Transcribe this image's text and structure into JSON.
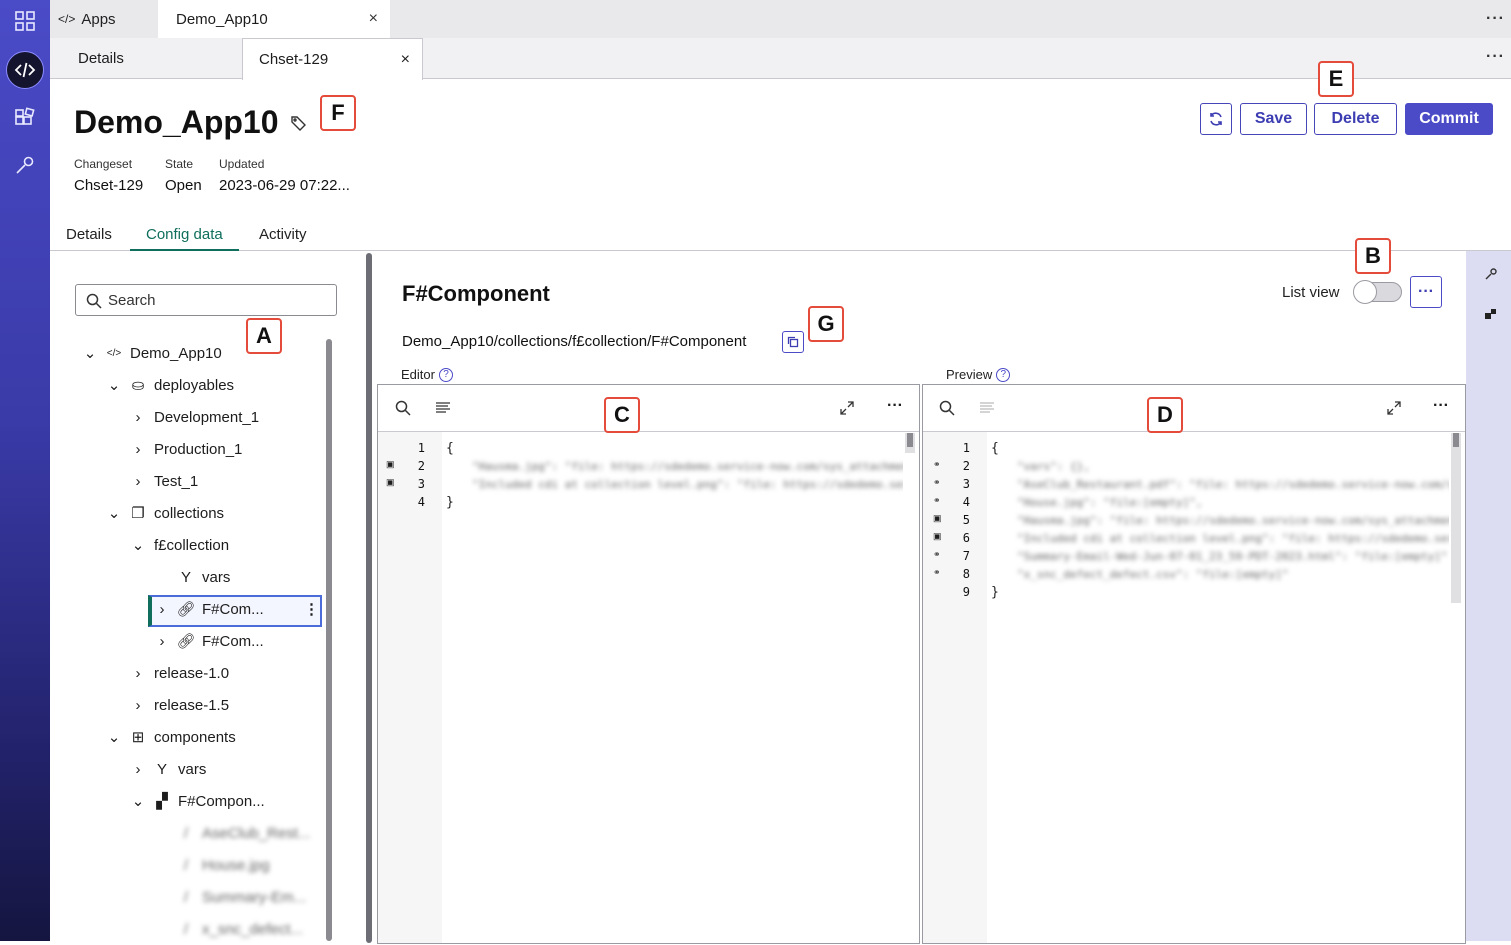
{
  "nav": {
    "items": [
      "grid-icon",
      "code-icon",
      "components-icon",
      "wrench-icon"
    ]
  },
  "top_tabs": {
    "apps_label": "Apps",
    "open_tab": "Demo_App10",
    "close": "×"
  },
  "sub_tabs": {
    "details": "Details",
    "changeset_tab": "Chset-129",
    "close": "×",
    "more": "···"
  },
  "header": {
    "title": "Demo_App10",
    "changeset_label": "Changeset",
    "changeset_value": "Chset-129",
    "state_label": "State",
    "state_value": "Open",
    "updated_label": "Updated",
    "updated_value": "2023-06-29 07:22..."
  },
  "actions": {
    "save": "Save",
    "delete": "Delete",
    "commit": "Commit"
  },
  "tabs": {
    "details": "Details",
    "config": "Config data",
    "activity": "Activity"
  },
  "tree": {
    "search_placeholder": "Search",
    "items": [
      "Demo_App10",
      "deployables",
      "Development_1",
      "Production_1",
      "Test_1",
      "collections",
      "f£collection",
      "vars",
      "F#Com...",
      "F#Com...",
      "release-1.0",
      "release-1.5",
      "components",
      "vars",
      "F#Compon...",
      "AseClub_Rest...",
      "House.jpg",
      "Summary-Em...",
      "x_snc_defect..."
    ]
  },
  "component": {
    "title": "F#Component",
    "path": "Demo_App10/collections/f£collection/F#Component",
    "list_view": "List view",
    "more": "···",
    "editor_label": "Editor",
    "preview_label": "Preview",
    "help": "?",
    "editor_lines": [
      "1",
      "2",
      "3",
      "4"
    ],
    "editor_code": [
      "{",
      "\"Hausma.jpg\": \"file: https://sdedemo.service-now.com/sys_attachment\"",
      "\"Included cdi at collection level.png\": \"file: https://sdedemo.service\"",
      "}"
    ],
    "preview_lines": [
      "1",
      "2",
      "3",
      "4",
      "5",
      "6",
      "7",
      "8",
      "9"
    ],
    "preview_code": [
      "{",
      "\"vars\": {},",
      "\"AseClub_Restaurant.pdf\": \"file: https://sdedemo.service-now.com/sys\"",
      "\"House.jpg\": \"file:[empty]\",",
      "\"Hausma.jpg\": \"file: https://sdedemo.service-now.com/sys_attachment\"",
      "\"Included cdi at collection level.png\": \"file: https://sdedemo.service\"",
      "\"Summary-Email-Wed-Jun-07-01_23_59-PDT-2023.html\": \"file:[empty]\"",
      "\"x_snc_defect_defect.csv\": \"file:[empty]\"",
      "}"
    ]
  },
  "callouts": {
    "A": "A",
    "B": "B",
    "C": "C",
    "D": "D",
    "E": "E",
    "F": "F",
    "G": "G"
  },
  "colors": {
    "accent": "#4b4bc8",
    "active_tab": "#0f6e5c",
    "callout_border": "#e44b3b"
  }
}
